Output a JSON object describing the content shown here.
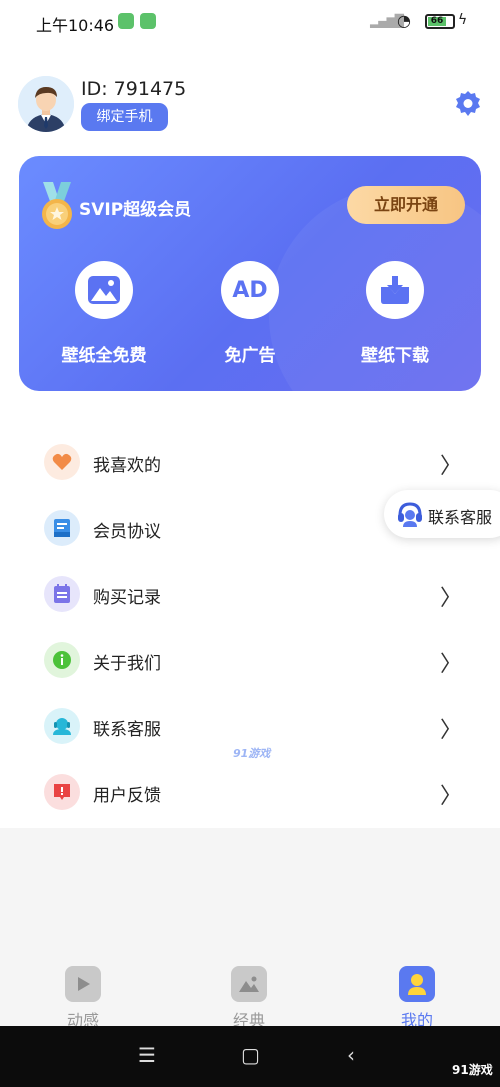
{
  "status_bar": {
    "time": "上午10:46",
    "battery": "66"
  },
  "profile": {
    "id_text": "ID: 791475",
    "bind_label": "绑定手机"
  },
  "vip": {
    "title": "SVIP超级会员",
    "open_label": "立即开通",
    "features": [
      {
        "label": "壁纸全免费",
        "icon": "image-icon"
      },
      {
        "label": "免广告",
        "icon": "ad-icon",
        "icon_text": "AD"
      },
      {
        "label": "壁纸下载",
        "icon": "download-icon"
      }
    ]
  },
  "menu": [
    {
      "label": "我喜欢的",
      "icon": "heart-icon",
      "color": "#f28b47",
      "bg": "#fdebe0"
    },
    {
      "label": "会员协议",
      "icon": "document-icon",
      "color": "#3a8ee6",
      "bg": "#dcecfb"
    },
    {
      "label": "购买记录",
      "icon": "receipt-icon",
      "color": "#7b74e8",
      "bg": "#e7e5fb"
    },
    {
      "label": "关于我们",
      "icon": "info-icon",
      "color": "#4cc23a",
      "bg": "#e1f5dc"
    },
    {
      "label": "联系客服",
      "icon": "headset-icon",
      "color": "#27b7d8",
      "bg": "#d9f3f9"
    },
    {
      "label": "用户反馈",
      "icon": "feedback-icon",
      "color": "#e94343",
      "bg": "#fbdede"
    }
  ],
  "float_service": {
    "label": "联系客服"
  },
  "tabs": [
    {
      "label": "动感",
      "active": false
    },
    {
      "label": "经典",
      "active": false
    },
    {
      "label": "我的",
      "active": true
    }
  ],
  "watermark": "91游戏",
  "center_watermark": "91游戏",
  "colors": {
    "accent": "#5a79f0",
    "vip_gold": "#f7c583",
    "tab_inactive": "#999999",
    "tab_active": "#5a79f0"
  }
}
